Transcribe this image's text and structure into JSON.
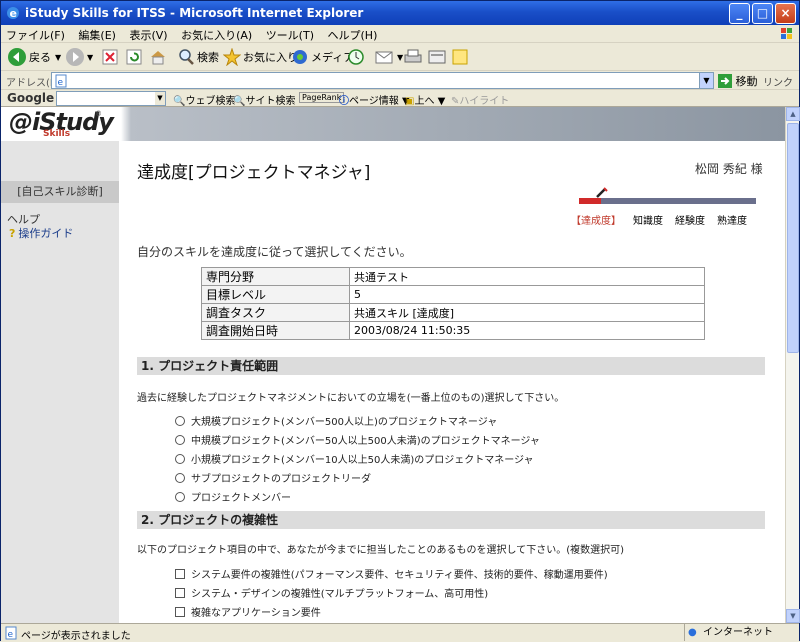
{
  "window": {
    "title": "iStudy Skills for ITSS - Microsoft Internet Explorer",
    "minimize": "_",
    "maximize": "□",
    "close": "×"
  },
  "menu": [
    "ファイル(F)",
    "編集(E)",
    "表示(V)",
    "お気に入り(A)",
    "ツール(T)",
    "ヘルプ(H)"
  ],
  "toolbar": {
    "back": "戻る",
    "search": "検索",
    "favorites": "お気に入り",
    "media": "メディア"
  },
  "address": {
    "label": "アドレス(D)",
    "value": "",
    "go": "移動",
    "links": "リンク"
  },
  "googlebar": {
    "logo": "Google",
    "web_search": "ウェブ検索",
    "site_search": "サイト検索",
    "pagerank": "PageRank",
    "page_info": "ページ情報",
    "up": "上へ",
    "highlight": "ハイライト"
  },
  "sidebar": {
    "logo": "@iStudy",
    "logo_sub": "Skills",
    "logo_reg": "®",
    "self_diag": "[自己スキル診断]",
    "help": "ヘルプ",
    "guide": "操作ガイド"
  },
  "main": {
    "title": "達成度[プロジェクトマネジャ]",
    "user": "松岡 秀紀 様",
    "steps": [
      "【達成度】",
      "知識度",
      "経験度",
      "熟達度"
    ],
    "instruction": "自分のスキルを達成度に従って選択してください。",
    "info_rows": [
      {
        "key": "専門分野",
        "value": "共通テスト"
      },
      {
        "key": "目標レベル",
        "value": "5"
      },
      {
        "key": "調査タスク",
        "value": "共通スキル [達成度]"
      },
      {
        "key": "調査開始日時",
        "value": "2003/08/24 11:50:35"
      }
    ],
    "section1": {
      "title": "1. プロジェクト責任範囲",
      "question": "過去に経験したプロジェクトマネジメントにおいての立場を(一番上位のもの)選択して下さい。",
      "options": [
        "大規模プロジェクト(メンバー500人以上)のプロジェクトマネージャ",
        "中規模プロジェクト(メンバー50人以上500人未満)のプロジェクトマネージャ",
        "小規模プロジェクト(メンバー10人以上50人未満)のプロジェクトマネージャ",
        "サブプロジェクトのプロジェクトリーダ",
        "プロジェクトメンバー"
      ]
    },
    "section2": {
      "title": "2. プロジェクトの複雑性",
      "question": "以下のプロジェクト項目の中で、あなたが今までに担当したことのあるものを選択して下さい。(複数選択可)",
      "options": [
        "システム要件の複雑性(パフォーマンス要件、セキュリティ要件、技術的要件、稼動運用要件)",
        "システム・デザインの複雑性(マルチプラットフォーム、高可用性)",
        "複雑なアプリケーション要件"
      ]
    }
  },
  "status": {
    "text": "ページが表示されました",
    "zone": "インターネット"
  }
}
